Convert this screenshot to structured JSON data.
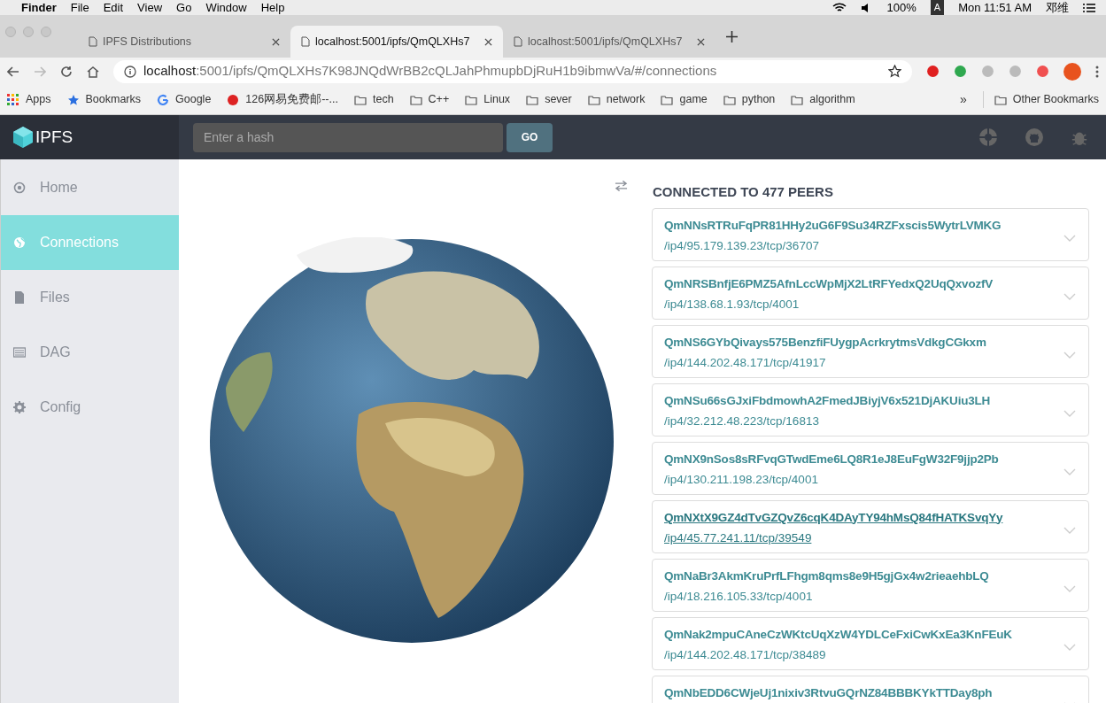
{
  "menubar": {
    "app": "Finder",
    "menus": [
      "File",
      "Edit",
      "View",
      "Go",
      "Window",
      "Help"
    ],
    "battery": "100%",
    "input_source": "A",
    "clock": "Mon 11:51 AM",
    "user": "邓维"
  },
  "tabs": [
    {
      "title": "IPFS Distributions",
      "selected": false
    },
    {
      "title": "localhost:5001/ipfs/QmQLXHs7",
      "selected": true
    },
    {
      "title": "localhost:5001/ipfs/QmQLXHs7",
      "selected": false
    }
  ],
  "address_bar": {
    "host": "localhost",
    "rest": ":5001/ipfs/QmQLXHs7K98JNQdWrBB2cQLJahPhmupbDjRuH1b9ibmwVa/#/connections"
  },
  "bookmarks": [
    {
      "label": "Apps",
      "kind": "apps"
    },
    {
      "label": "Bookmarks",
      "kind": "star"
    },
    {
      "label": "Google",
      "kind": "google"
    },
    {
      "label": "126网易免费邮--...",
      "kind": "mail"
    },
    {
      "label": "tech",
      "kind": "folder"
    },
    {
      "label": "C++",
      "kind": "folder"
    },
    {
      "label": "Linux",
      "kind": "folder"
    },
    {
      "label": "sever",
      "kind": "folder"
    },
    {
      "label": "network",
      "kind": "folder"
    },
    {
      "label": "game",
      "kind": "folder"
    },
    {
      "label": "python",
      "kind": "folder"
    },
    {
      "label": "algorithm",
      "kind": "folder"
    }
  ],
  "bookmarks_overflow": "»",
  "other_bookmarks": "Other Bookmarks",
  "app": {
    "logo": "IPFS",
    "search": {
      "placeholder": "Enter a hash"
    },
    "go_button": "GO"
  },
  "sidebar": {
    "items": [
      {
        "label": "Home",
        "kind": "home",
        "selected": false
      },
      {
        "label": "Connections",
        "kind": "globe",
        "selected": true
      },
      {
        "label": "Files",
        "kind": "file",
        "selected": false
      },
      {
        "label": "DAG",
        "kind": "dag",
        "selected": false
      },
      {
        "label": "Config",
        "kind": "config",
        "selected": false
      }
    ]
  },
  "peers_heading": "CONNECTED TO 477 PEERS",
  "peers": [
    {
      "id": "QmNNsRTRuFqPR81HHy2uG6F9Su34RZFxscis5WytrLVMKG",
      "address": "/ip4/95.179.139.23/tcp/36707",
      "hovered": false
    },
    {
      "id": "QmNRSBnfjE6PMZ5AfnLccWpMjX2LtRFYedxQ2UqQxvozfV",
      "address": "/ip4/138.68.1.93/tcp/4001",
      "hovered": false
    },
    {
      "id": "QmNS6GYbQivays575BenzfiFUygpAcrkrytmsVdkgCGkxm",
      "address": "/ip4/144.202.48.171/tcp/41917",
      "hovered": false
    },
    {
      "id": "QmNSu66sGJxiFbdmowhA2FmedJBiyjV6x521DjAKUiu3LH",
      "address": "/ip4/32.212.48.223/tcp/16813",
      "hovered": false
    },
    {
      "id": "QmNX9nSos8sRFvqGTwdEme6LQ8R1eJ8EuFgW32F9jjp2Pb",
      "address": "/ip4/130.211.198.23/tcp/4001",
      "hovered": false
    },
    {
      "id": "QmNXtX9GZ4dTvGZQvZ6cqK4DAyTY94hMsQ84fHATKSvqYy",
      "address": "/ip4/45.77.241.11/tcp/39549",
      "hovered": true
    },
    {
      "id": "QmNaBr3AkmKruPrfLFhgm8qms8e9H5gjGx4w2rieaehbLQ",
      "address": "/ip4/18.216.105.33/tcp/4001",
      "hovered": false
    },
    {
      "id": "QmNak2mpuCAneCzWKtcUqXzW4YDLCeFxiCwKxEa3KnFEuK",
      "address": "/ip4/144.202.48.171/tcp/38489",
      "hovered": false
    },
    {
      "id": "QmNbEDD6CWjeUj1nixiv3RtvuGQrNZ84BBBKYkTTDay8ph",
      "hovered": false
    }
  ]
}
